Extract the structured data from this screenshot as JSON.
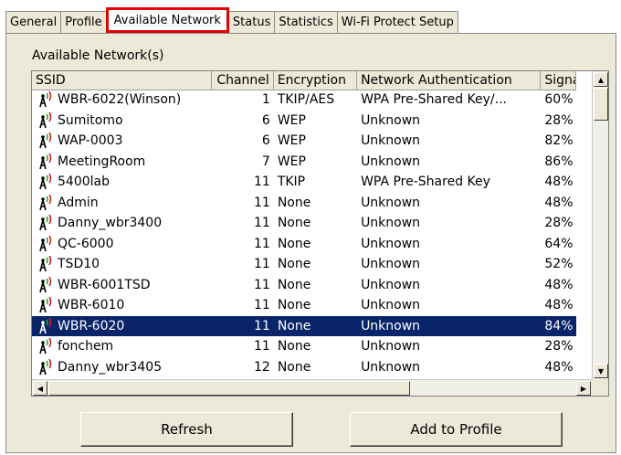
{
  "tabs": [
    "General",
    "Profile",
    "Available Network",
    "Status",
    "Statistics",
    "Wi-Fi Protect Setup"
  ],
  "active_tab_index": 2,
  "group_label": "Available Network(s)",
  "columns": [
    "SSID",
    "Channel",
    "Encryption",
    "Network Authentication",
    "Signa"
  ],
  "rows": [
    {
      "ssid": "WBR-6022(Winson)",
      "channel": "1",
      "encryption": "TKIP/AES",
      "auth": "WPA Pre-Shared Key/...",
      "signal": "60%"
    },
    {
      "ssid": "Sumitomo",
      "channel": "6",
      "encryption": "WEP",
      "auth": "Unknown",
      "signal": "28%"
    },
    {
      "ssid": "WAP-0003",
      "channel": "6",
      "encryption": "WEP",
      "auth": "Unknown",
      "signal": "82%"
    },
    {
      "ssid": "MeetingRoom",
      "channel": "7",
      "encryption": "WEP",
      "auth": "Unknown",
      "signal": "86%"
    },
    {
      "ssid": "5400lab",
      "channel": "11",
      "encryption": "TKIP",
      "auth": "WPA Pre-Shared Key",
      "signal": "48%"
    },
    {
      "ssid": "Admin",
      "channel": "11",
      "encryption": "None",
      "auth": "Unknown",
      "signal": "48%"
    },
    {
      "ssid": "Danny_wbr3400",
      "channel": "11",
      "encryption": "None",
      "auth": "Unknown",
      "signal": "28%"
    },
    {
      "ssid": "QC-6000",
      "channel": "11",
      "encryption": "None",
      "auth": "Unknown",
      "signal": "64%"
    },
    {
      "ssid": "TSD10",
      "channel": "11",
      "encryption": "None",
      "auth": "Unknown",
      "signal": "52%"
    },
    {
      "ssid": "WBR-6001TSD",
      "channel": "11",
      "encryption": "None",
      "auth": "Unknown",
      "signal": "48%"
    },
    {
      "ssid": "WBR-6010",
      "channel": "11",
      "encryption": "None",
      "auth": "Unknown",
      "signal": "48%"
    },
    {
      "ssid": "WBR-6020",
      "channel": "11",
      "encryption": "None",
      "auth": "Unknown",
      "signal": "84%",
      "selected": true
    },
    {
      "ssid": "fonchem",
      "channel": "11",
      "encryption": "None",
      "auth": "Unknown",
      "signal": "28%"
    },
    {
      "ssid": "Danny_wbr3405",
      "channel": "12",
      "encryption": "None",
      "auth": "Unknown",
      "signal": "48%"
    }
  ],
  "buttons": {
    "refresh": "Refresh",
    "add_to_profile": "Add to Profile"
  },
  "icons": {
    "network": "wireless-signal-icon",
    "scroll_up": "arrow-up-icon",
    "scroll_down": "arrow-down-icon",
    "scroll_left": "arrow-left-icon",
    "scroll_right": "arrow-right-icon"
  },
  "colors": {
    "selection": "#0a246a",
    "highlight_border": "#e00000",
    "icon_green": "#2aa52a"
  }
}
